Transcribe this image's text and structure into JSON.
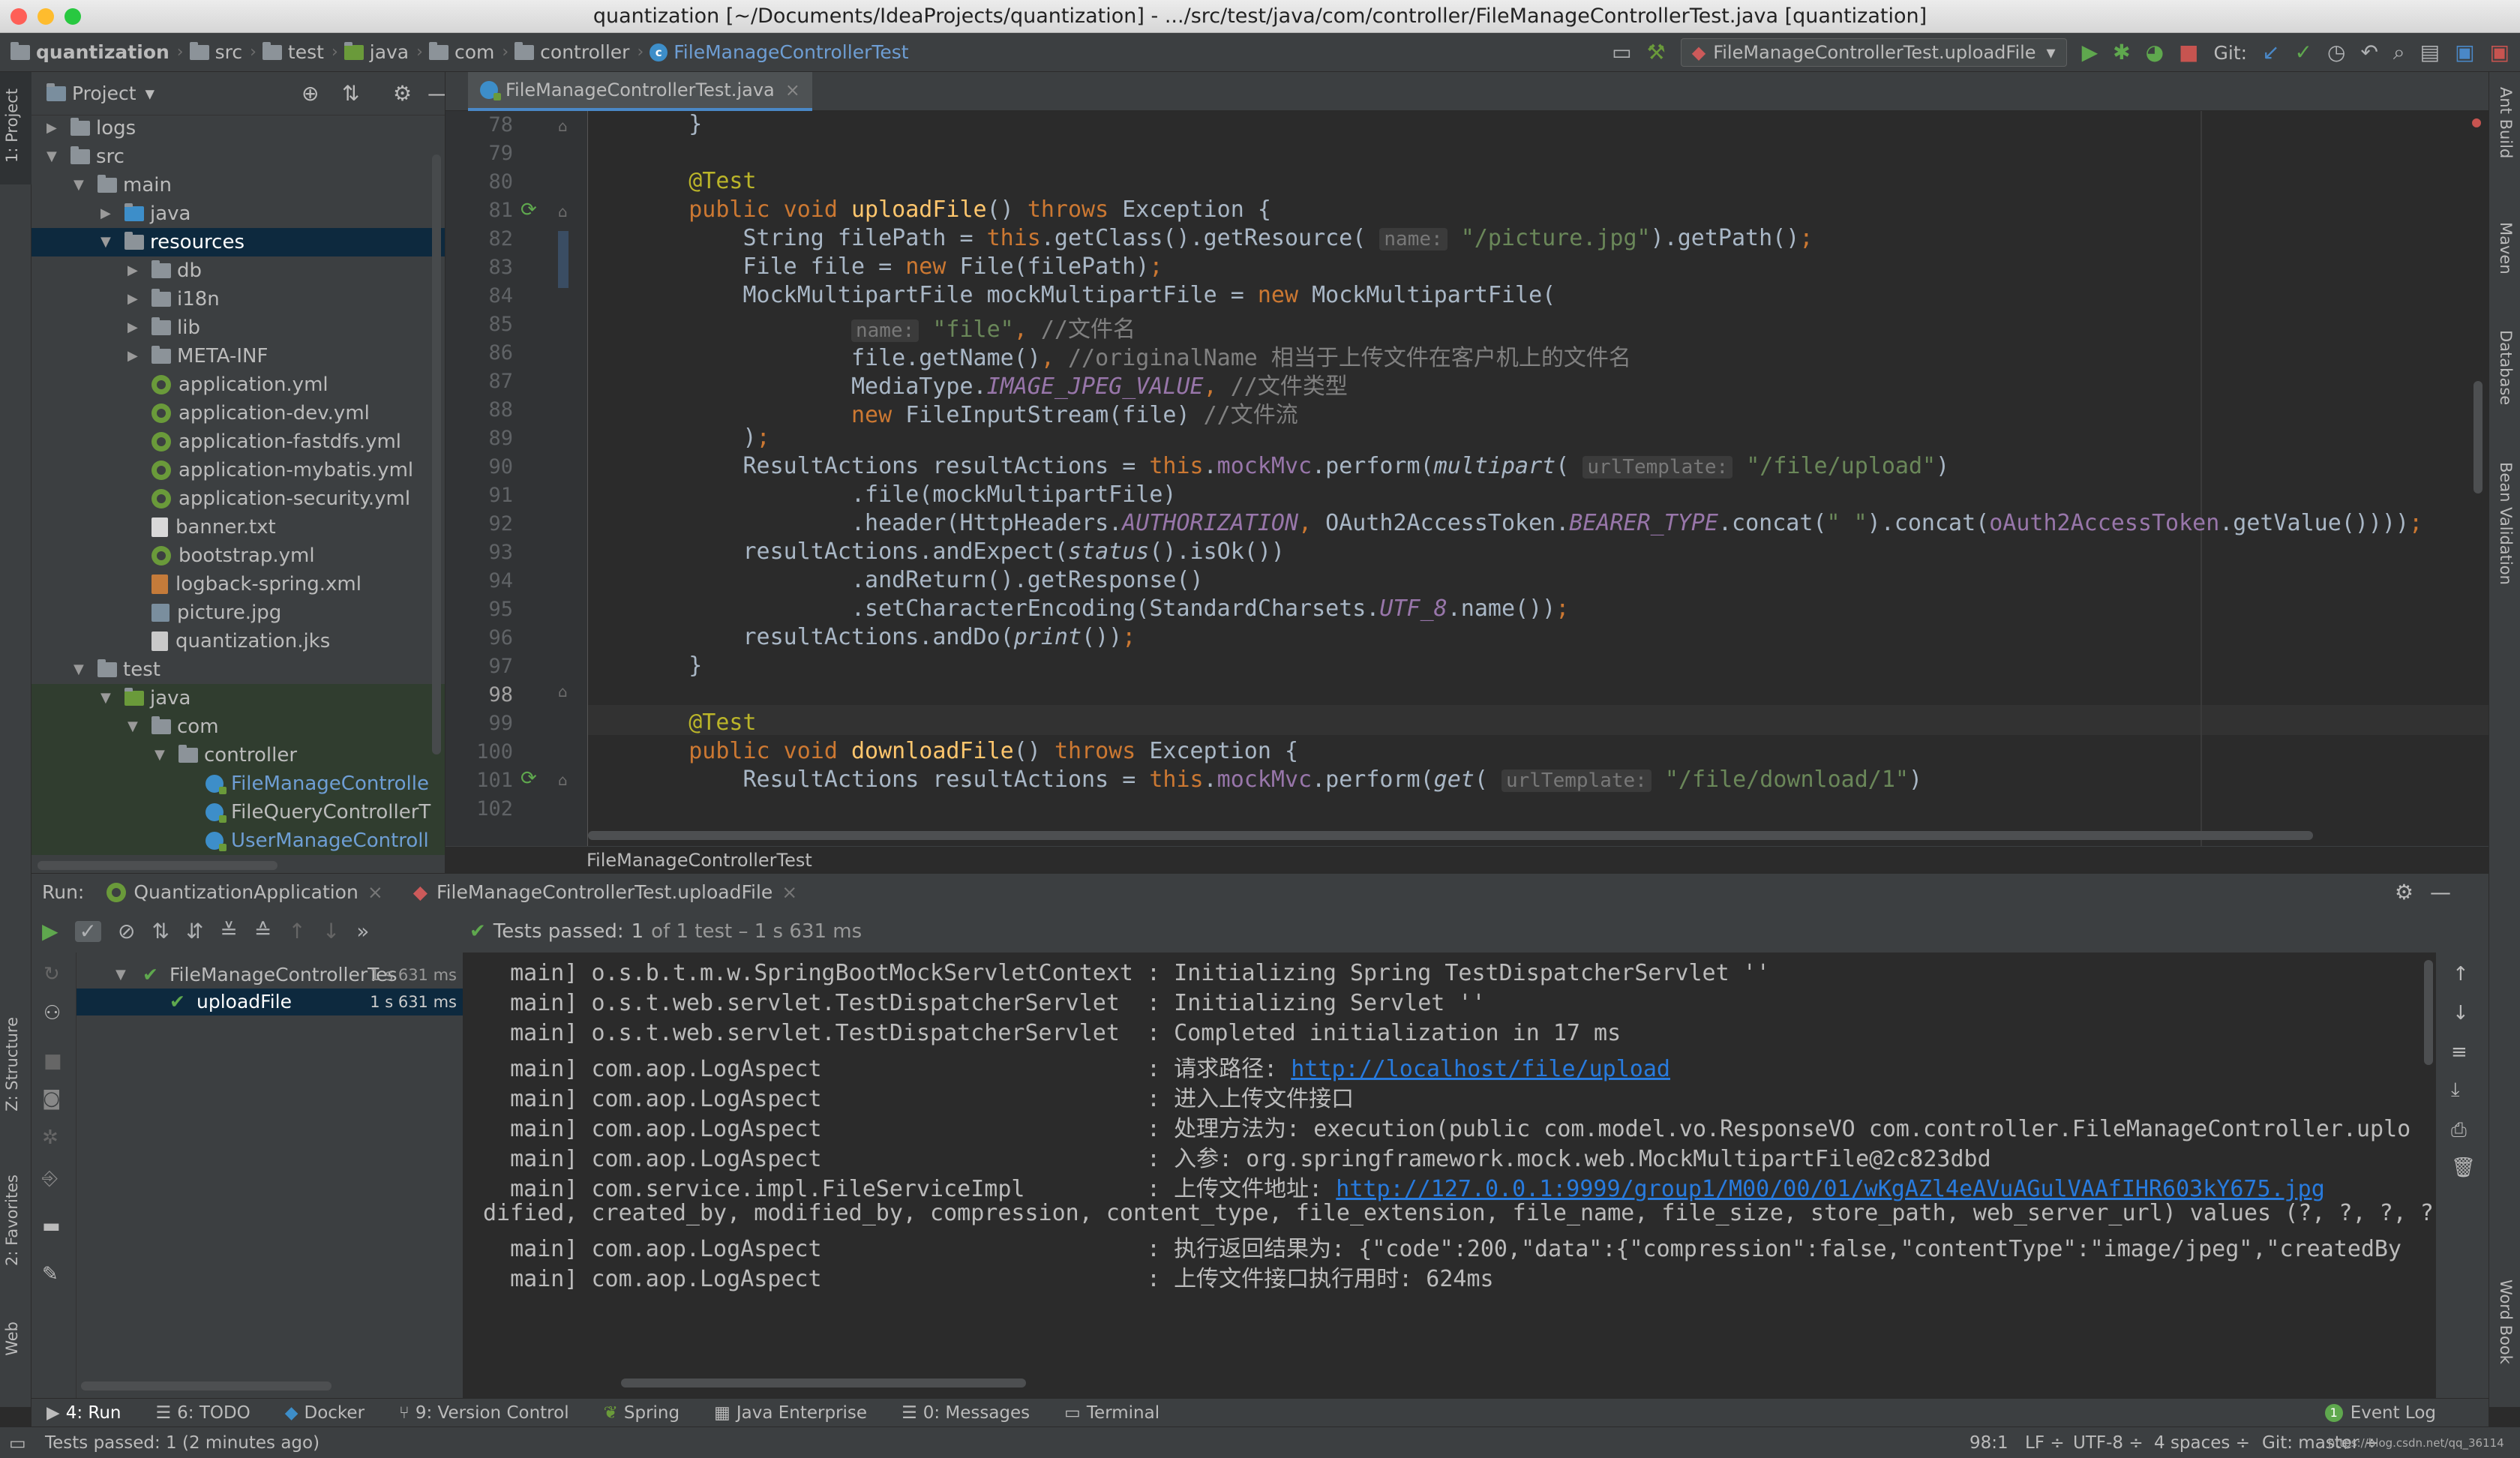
{
  "window": {
    "title": "quantization [~/Documents/IdeaProjects/quantization] - .../src/test/java/com/controller/FileManageControllerTest.java [quantization]"
  },
  "breadcrumb": [
    "quantization",
    "src",
    "test",
    "java",
    "com",
    "controller",
    "FileManageControllerTest"
  ],
  "toolbar": {
    "run_config": "FileManageControllerTest.uploadFile",
    "git_label": "Git:"
  },
  "project_panel": {
    "title": "Project",
    "tree": [
      {
        "label": "logs",
        "depth": 0,
        "type": "folder",
        "expanded": false
      },
      {
        "label": "src",
        "depth": 0,
        "type": "folder",
        "expanded": true
      },
      {
        "label": "main",
        "depth": 1,
        "type": "folder",
        "expanded": true
      },
      {
        "label": "java",
        "depth": 2,
        "type": "src-folder",
        "expanded": false
      },
      {
        "label": "resources",
        "depth": 2,
        "type": "res-folder",
        "expanded": true,
        "selected": true
      },
      {
        "label": "db",
        "depth": 3,
        "type": "folder",
        "expanded": false
      },
      {
        "label": "i18n",
        "depth": 3,
        "type": "folder",
        "expanded": false
      },
      {
        "label": "lib",
        "depth": 3,
        "type": "folder",
        "expanded": false
      },
      {
        "label": "META-INF",
        "depth": 3,
        "type": "folder",
        "expanded": false
      },
      {
        "label": "application.yml",
        "depth": 3,
        "type": "spring"
      },
      {
        "label": "application-dev.yml",
        "depth": 3,
        "type": "spring"
      },
      {
        "label": "application-fastdfs.yml",
        "depth": 3,
        "type": "spring"
      },
      {
        "label": "application-mybatis.yml",
        "depth": 3,
        "type": "spring"
      },
      {
        "label": "application-security.yml",
        "depth": 3,
        "type": "spring"
      },
      {
        "label": "banner.txt",
        "depth": 3,
        "type": "text"
      },
      {
        "label": "bootstrap.yml",
        "depth": 3,
        "type": "spring"
      },
      {
        "label": "logback-spring.xml",
        "depth": 3,
        "type": "xml"
      },
      {
        "label": "picture.jpg",
        "depth": 3,
        "type": "image"
      },
      {
        "label": "quantization.jks",
        "depth": 3,
        "type": "file"
      },
      {
        "label": "test",
        "depth": 1,
        "type": "folder",
        "expanded": true
      },
      {
        "label": "java",
        "depth": 2,
        "type": "test-folder",
        "expanded": true,
        "green": true
      },
      {
        "label": "com",
        "depth": 3,
        "type": "folder",
        "expanded": true,
        "green": true
      },
      {
        "label": "controller",
        "depth": 4,
        "type": "folder",
        "expanded": true,
        "green": true
      },
      {
        "label": "FileManageControlle",
        "depth": 5,
        "type": "class",
        "green": true,
        "blue": true
      },
      {
        "label": "FileQueryControllerT",
        "depth": 5,
        "type": "class",
        "green": true
      },
      {
        "label": "UserManageControll",
        "depth": 5,
        "type": "class",
        "green": true,
        "blue": true
      }
    ]
  },
  "editor": {
    "tab": "FileManageControllerTest.java",
    "breadcrumb": "FileManageControllerTest",
    "line_numbers": [
      "78",
      "79",
      "80",
      "81",
      "82",
      "83",
      "84",
      "85",
      "86",
      "87",
      "88",
      "89",
      "90",
      "91",
      "92",
      "93",
      "94",
      "95",
      "96",
      "97",
      "98",
      "99",
      "100",
      "101",
      "102"
    ]
  },
  "run_panel": {
    "label": "Run:",
    "tabs": [
      "QuantizationApplication",
      "FileManageControllerTest.uploadFile"
    ],
    "tests_passed_prefix": "Tests passed:",
    "tests_passed_count": "1",
    "tests_passed_suffix": "of 1 test – 1 s 631 ms",
    "tree": [
      {
        "label": "FileManageControllerTes",
        "time": "1 s 631 ms"
      },
      {
        "label": "uploadFile",
        "time": "1 s 631 ms"
      }
    ],
    "console": [
      {
        "pre": "  main] o.s.b.t.m.w.SpringBootMockServletContext : Initializing Spring TestDispatcherServlet ''"
      },
      {
        "pre": "  main] o.s.t.web.servlet.TestDispatcherServlet  : Initializing Servlet ''"
      },
      {
        "pre": "  main] o.s.t.web.servlet.TestDispatcherServlet  : Completed initialization in 17 ms"
      },
      {
        "pre": "  main] com.aop.LogAspect                        : 请求路径: ",
        "link": "http://localhost/file/upload"
      },
      {
        "pre": "  main] com.aop.LogAspect                        : 进入上传文件接口"
      },
      {
        "pre": "  main] com.aop.LogAspect                        : 处理方法为: execution(public com.model.vo.ResponseVO com.controller.FileManageController.uplo"
      },
      {
        "pre": "  main] com.aop.LogAspect                        : 入参: org.springframework.mock.web.MockMultipartFile@2c823dbd"
      },
      {
        "pre": "  main] com.service.impl.FileServiceImpl         : 上传文件地址: ",
        "link": "http://127.0.0.1:9999/group1/M00/00/01/wKgAZl4eAVuAGulVAAfIHR603kY675.jpg"
      },
      {
        "pre": "dified, created_by, modified_by, compression, content_type, file_extension, file_name, file_size, store_path, web_server_url) values (?, ?, ?, ?"
      },
      {
        "pre": "  main] com.aop.LogAspect                        : 执行返回结果为: {\"code\":200,\"data\":{\"compression\":false,\"contentType\":\"image/jpeg\",\"createdBy"
      },
      {
        "pre": "  main] com.aop.LogAspect                        : 上传文件接口执行用时: 624ms"
      }
    ]
  },
  "tool_windows": [
    {
      "label": "4: Run",
      "icon": "run-icon"
    },
    {
      "label": "6: TODO",
      "icon": "todo-icon"
    },
    {
      "label": "Docker",
      "icon": "docker-icon"
    },
    {
      "label": "9: Version Control",
      "icon": "vcs-icon"
    },
    {
      "label": "Spring",
      "icon": "spring-icon"
    },
    {
      "label": "Java Enterprise",
      "icon": "java-enterprise-icon"
    },
    {
      "label": "0: Messages",
      "icon": "messages-icon"
    },
    {
      "label": "Terminal",
      "icon": "terminal-icon"
    }
  ],
  "event_log": {
    "label": "Event Log",
    "count": "1"
  },
  "left_strip": {
    "project": "1: Project",
    "structure": "Z: Structure",
    "favorites": "2: Favorites",
    "web": "Web"
  },
  "right_strip": {
    "ant": "Ant Build",
    "maven": "Maven",
    "database": "Database",
    "bean": "Bean Validation",
    "wordbook": "Word Book"
  },
  "status_bar": {
    "message": "Tests passed: 1 (2 minutes ago)",
    "position": "98:1",
    "line_sep": "LF ÷",
    "encoding": "UTF-8 ÷",
    "indent": "4 spaces ÷",
    "git": "Git: master ÷",
    "watermark": "https://blog.csdn.net/qq_36114"
  },
  "colors": {
    "accent": "#4a88c7",
    "selection": "#0d293e",
    "test_bg": "#303d2f",
    "pass": "#5fa84e"
  }
}
